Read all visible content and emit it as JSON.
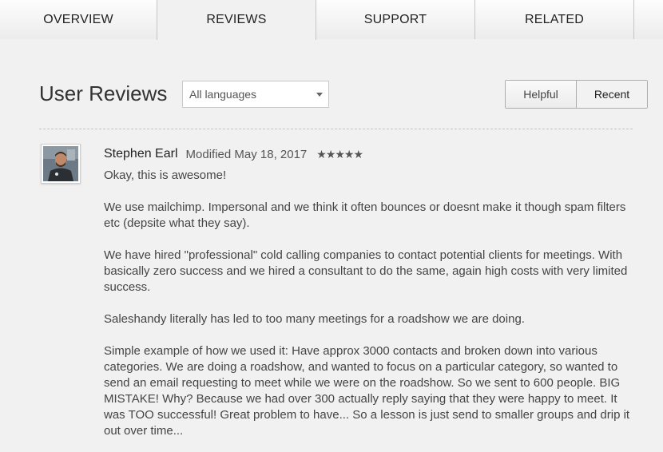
{
  "tabs": [
    {
      "label": "Overview",
      "active": false
    },
    {
      "label": "Reviews",
      "active": true
    },
    {
      "label": "Support",
      "active": false
    },
    {
      "label": "Related",
      "active": false
    }
  ],
  "section": {
    "title": "User Reviews",
    "language_select": {
      "value": "All languages"
    },
    "sort": {
      "helpful_label": "Helpful",
      "recent_label": "Recent",
      "selected": "Recent"
    }
  },
  "review": {
    "author": "Stephen Earl",
    "modified": "Modified May 18, 2017",
    "rating": 5,
    "rating_stars": "★★★★★",
    "paragraphs": [
      "Okay, this is awesome!",
      "We use mailchimp. Impersonal and we think it often bounces or doesnt make it though spam filters etc (depsite what they say).",
      "We have hired \"professional\" cold calling companies to contact potential clients for meetings. With basically zero success and we hired a consultant to do the same, again high costs with very limited success.",
      "Saleshandy literally has led to too many meetings for a roadshow we are doing.",
      "Simple example of how we used it: Have approx 3000 contacts and broken down into various categories. We are doing a roadshow, and wanted to focus on a particular category, so wanted to send an email requesting to meet while we were on the roadshow. So we sent to 600 people. BIG MISTAKE! Why? Because we had over 300 actually reply saying that they were happy to meet. It was TOO successful! Great problem to have... So a lesson is just send to smaller groups and drip it out over time..."
    ]
  }
}
